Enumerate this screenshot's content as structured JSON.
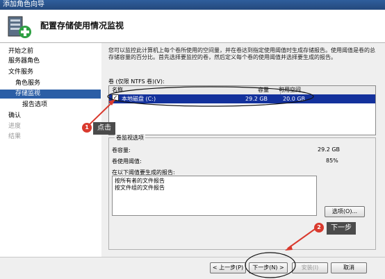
{
  "window": {
    "title": "添加角色向导"
  },
  "header": {
    "title": "配置存储使用情况监视",
    "icon": "server-add-icon"
  },
  "nav": {
    "items": [
      {
        "label": "开始之前",
        "state": "normal"
      },
      {
        "label": "服务器角色",
        "state": "normal"
      },
      {
        "label": "文件服务",
        "state": "normal"
      },
      {
        "label": "角色服务",
        "state": "normal"
      },
      {
        "label": "存储监视",
        "state": "selected"
      },
      {
        "label": "报告选项",
        "state": "normal"
      },
      {
        "label": "确认",
        "state": "normal"
      },
      {
        "label": "进度",
        "state": "disabled"
      },
      {
        "label": "结果",
        "state": "disabled"
      }
    ]
  },
  "content": {
    "description": "您可以监控此计算机上每个卷所使用的空间量，并在卷达到指定使用阈值时生成存储报告。使用阈值是卷的总存储容量的百分比。首先选择要监控的卷，然后定义每个卷的使用阈值并选择要生成的报告。",
    "volume_list_label": "卷 (仅限 NTFS 卷)(V):",
    "columns": {
      "name": "名称",
      "capacity": "容量",
      "free": "可用空间"
    },
    "volumes": [
      {
        "checked": true,
        "name": "本地磁盘 (C:)",
        "capacity": "29.2 GB",
        "free": "20.0 GB"
      }
    ],
    "options_group": {
      "title": "卷监视选项",
      "capacity_label": "卷容量:",
      "capacity_value": "29.2 GB",
      "threshold_label": "卷使用阈值:",
      "threshold_value": "85%",
      "report_label": "在以下阈值要生成的报告:",
      "reports": [
        "按所有者的文件报告",
        "按文件组的文件报告"
      ],
      "options_button": "选项(O)..."
    }
  },
  "footer": {
    "prev": "< 上一步(P)",
    "next": "下一步(N) >",
    "install": "安装(I)",
    "cancel": "取消"
  },
  "annotations": {
    "badge1": "1",
    "tip1": "点击",
    "badge2": "2",
    "tip2": "下一步",
    "color": "#d93a2e"
  }
}
